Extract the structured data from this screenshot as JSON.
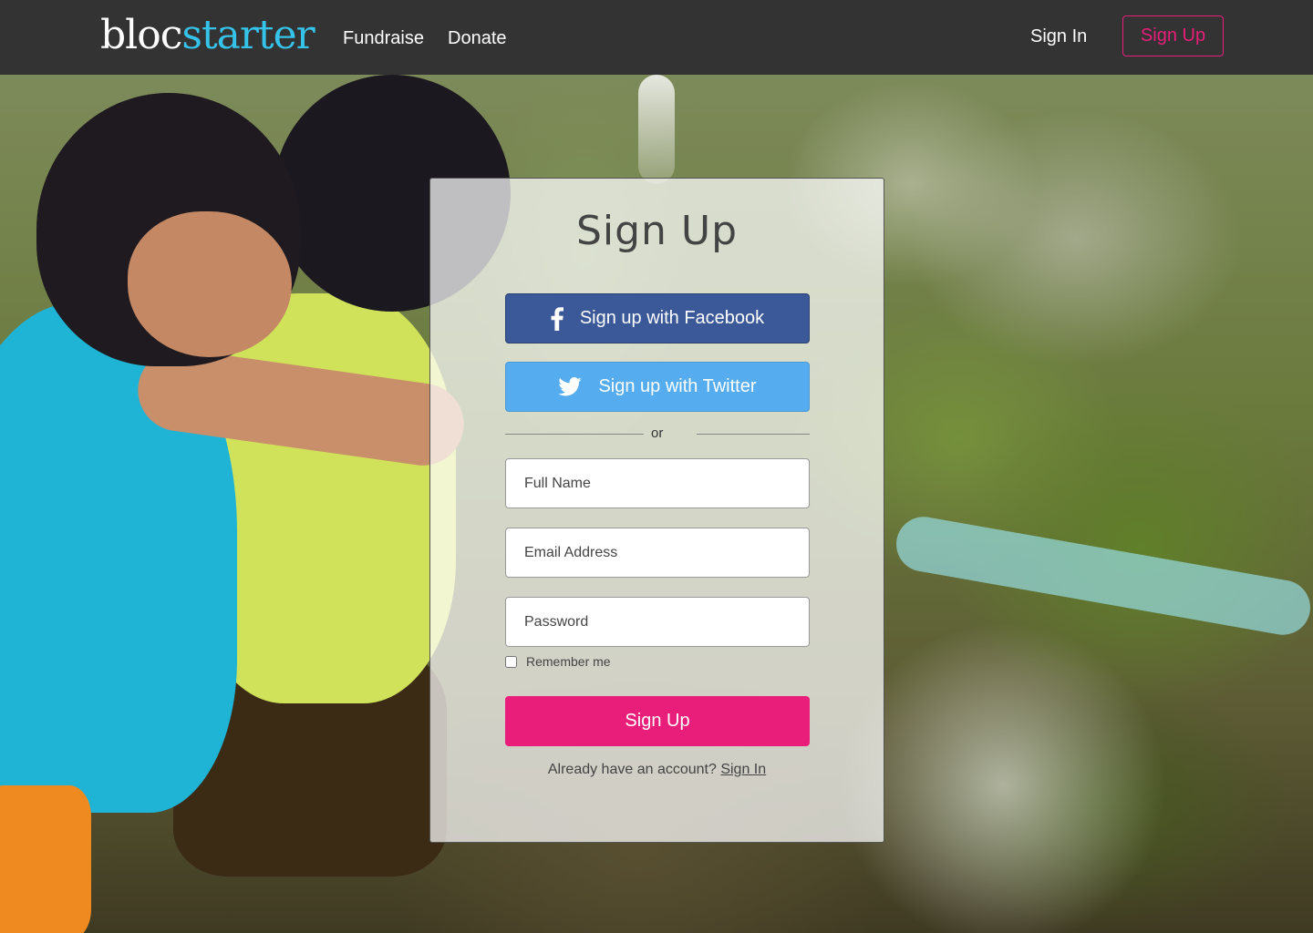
{
  "nav": {
    "logo_part1": "bloc",
    "logo_part2": "starter",
    "fundraise": "Fundraise",
    "donate": "Donate",
    "sign_in": "Sign In",
    "sign_up": "Sign Up"
  },
  "form": {
    "title": "Sign Up",
    "facebook_label": "Sign up with Facebook",
    "twitter_label": "Sign up with Twitter",
    "divider": "or",
    "full_name_placeholder": "Full Name",
    "email_placeholder": "Email Address",
    "password_placeholder": "Password",
    "remember_label": "Remember me",
    "remember_checked": false,
    "submit_label": "Sign Up",
    "account_prompt": "Already have an account?",
    "account_link": "Sign In"
  },
  "colors": {
    "accent": "#e91e7a",
    "logo_accent": "#35c3e9",
    "facebook": "#3b5998",
    "twitter": "#55acee",
    "navbar": "#333333"
  },
  "icons": {
    "facebook": "facebook-icon",
    "twitter": "twitter-icon"
  }
}
